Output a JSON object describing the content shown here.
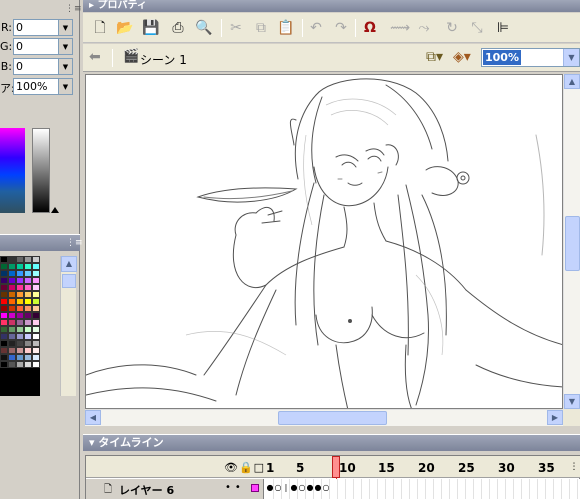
{
  "color_mixer": {
    "rows": [
      {
        "label": "R:",
        "value": "0"
      },
      {
        "label": "G:",
        "value": "0"
      },
      {
        "label": "B:",
        "value": "0"
      },
      {
        "label": "ア:",
        "value": "100%"
      }
    ]
  },
  "swatches": {
    "colors": [
      "#000000",
      "#333333",
      "#666666",
      "#999999",
      "#cccccc",
      "#006633",
      "#009966",
      "#00cc99",
      "#33ffcc",
      "#66ffff",
      "#003366",
      "#0066cc",
      "#3399ff",
      "#66ccff",
      "#99ffff",
      "#330066",
      "#6600cc",
      "#9933ff",
      "#cc66ff",
      "#ff99ff",
      "#660033",
      "#cc0066",
      "#ff3399",
      "#ff66cc",
      "#ffccff",
      "#663300",
      "#cc6600",
      "#ff9933",
      "#ffcc66",
      "#ffff99",
      "#ff0000",
      "#ff6600",
      "#ffcc00",
      "#ffff00",
      "#ccff33",
      "#990000",
      "#cc3300",
      "#ff6633",
      "#ff9966",
      "#ffcc99",
      "#ff00ff",
      "#cc00cc",
      "#990099",
      "#660066",
      "#330033",
      "#ff3366",
      "#cc3366",
      "#996699",
      "#cc99cc",
      "#ffccee",
      "#336633",
      "#669966",
      "#99cc99",
      "#ccffcc",
      "#e6ffe6",
      "#333366",
      "#666699",
      "#9999cc",
      "#ccccff",
      "#ffffff",
      "#000000",
      "#222222",
      "#444444",
      "#888888",
      "#bbbbbb",
      "#663333",
      "#996666",
      "#cc9999",
      "#ffcccc",
      "#ffeeee",
      "#111111",
      "#3366cc",
      "#6699cc",
      "#99bbdd",
      "#ddeeff",
      "#000000",
      "#555555",
      "#aaaaaa",
      "#dddddd",
      "#ffffff"
    ]
  },
  "properties": {
    "title": "プロパティ"
  },
  "toolbar": {
    "icons": [
      "new-file-icon",
      "open-folder-icon",
      "save-icon",
      "print-icon",
      "print-preview-icon",
      "cut-icon",
      "copy-icon",
      "paste-icon",
      "undo-icon",
      "redo-icon",
      "snap-magnet-icon",
      "smooth-icon",
      "straighten-icon",
      "rotate-icon",
      "scale-icon",
      "align-icon"
    ]
  },
  "scene_bar": {
    "scene_label": "シーン 1",
    "zoom": "100%"
  },
  "timeline": {
    "title": "タイムライン",
    "ruler": [
      "1",
      "5",
      "10",
      "15",
      "20",
      "25",
      "30",
      "35"
    ],
    "layer_name": "レイヤー 6",
    "keyframes": [
      "●",
      "○",
      "|",
      "●",
      "○",
      "●",
      "●",
      "○"
    ]
  },
  "colors": {
    "panel_bg": "#d4d0c8",
    "toolbar_bg": "#ece9d8",
    "title_bar": "#7d849a",
    "scrollbar_blue": "#c3d3fd",
    "selection": "#316ac5",
    "playhead": "#e02020"
  }
}
